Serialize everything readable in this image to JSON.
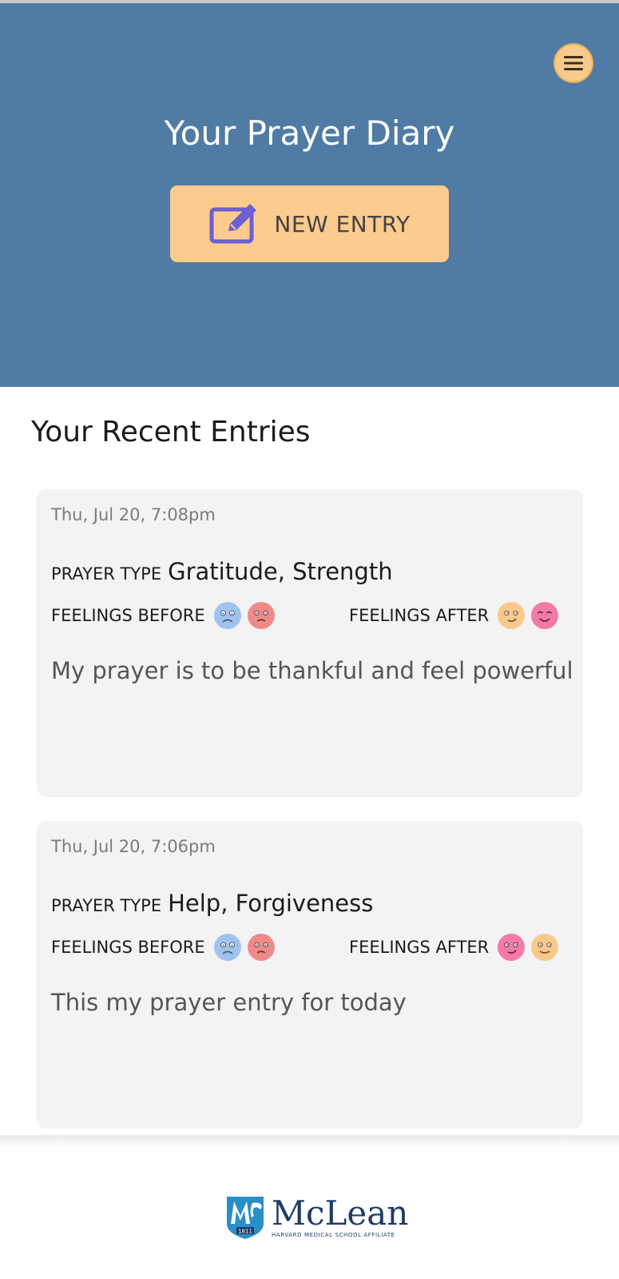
{
  "header": {
    "title": "Your Prayer Diary",
    "new_entry_label": "NEW ENTRY",
    "menu_icon": "hamburger-icon",
    "edit_icon": "edit-square-icon"
  },
  "recent": {
    "title": "Your Recent Entries",
    "entries": [
      {
        "date": "Thu, Jul 20, 7:08pm",
        "prayer_type_label": "PRAYER TYPE",
        "prayer_type": "Gratitude, Strength",
        "feelings_before_label": "FEELINGS BEFORE",
        "feelings_before": [
          "sad-face-icon",
          "upset-face-icon"
        ],
        "feelings_after_label": "FEELINGS AFTER",
        "feelings_after": [
          "content-face-icon",
          "happy-face-icon"
        ],
        "text": "My prayer is to be thankful and feel powerful"
      },
      {
        "date": "Thu, Jul 20, 7:06pm",
        "prayer_type_label": "PRAYER TYPE",
        "prayer_type": "Help, Forgiveness",
        "feelings_before_label": "FEELINGS BEFORE",
        "feelings_before": [
          "sad-face-icon",
          "upset-face-icon"
        ],
        "feelings_after_label": "FEELINGS AFTER",
        "feelings_after": [
          "happy-face-icon",
          "content-face-icon"
        ],
        "text": "This my prayer entry for today"
      }
    ]
  },
  "footer": {
    "logo_name": "McLean",
    "logo_subtitle": "HARVARD MEDICAL SCHOOL AFFILIATE",
    "logo_year": "1811"
  },
  "colors": {
    "header_bg": "#4f7ba4",
    "accent": "#fccb8d",
    "card_bg": "#f3f3f4",
    "edit_icon": "#6b5fd3"
  }
}
